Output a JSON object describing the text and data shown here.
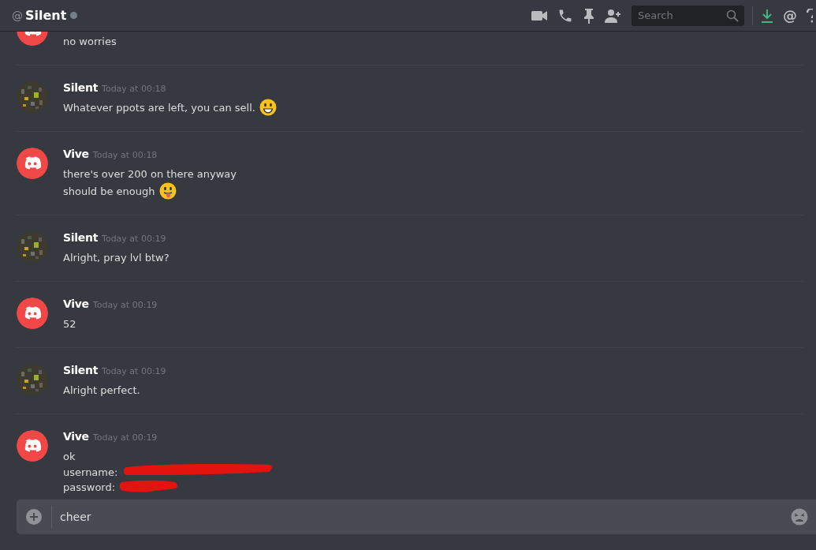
{
  "header": {
    "at_sign": "@",
    "title": "Silent",
    "status": {
      "kind": "offline"
    },
    "search": {
      "placeholder": "Search"
    }
  },
  "messages": [
    {
      "avatar": {
        "kind": "logo"
      },
      "lines": [
        {
          "text": "no worries"
        }
      ]
    },
    {
      "avatar": {
        "kind": "picture"
      },
      "author": "Silent",
      "time": "Today at 00:18",
      "lines": [
        {
          "text": "Whatever ppots are left, you can sell.",
          "emoji": {
            "kind": "smile"
          }
        }
      ]
    },
    {
      "avatar": {
        "kind": "logo"
      },
      "author": "Vive",
      "time": "Today at 00:18",
      "lines": [
        {
          "text": "there's over 200 on there anyway"
        },
        {
          "text": "should be enough",
          "emoji": {
            "kind": "tongue"
          }
        }
      ]
    },
    {
      "avatar": {
        "kind": "picture"
      },
      "author": "Silent",
      "time": "Today at 00:19",
      "lines": [
        {
          "text": "Alright, pray lvl btw?"
        }
      ]
    },
    {
      "avatar": {
        "kind": "logo"
      },
      "author": "Vive",
      "time": "Today at 00:19",
      "lines": [
        {
          "text": "52"
        }
      ]
    },
    {
      "avatar": {
        "kind": "picture"
      },
      "author": "Silent",
      "time": "Today at 00:19",
      "lines": [
        {
          "text": "Alright perfect."
        }
      ]
    },
    {
      "avatar": {
        "kind": "logo"
      },
      "author": "Vive",
      "time": "Today at 00:19",
      "lines": [
        {
          "text": "ok"
        },
        {
          "text": "username:",
          "redaction": {
            "kind": "long"
          }
        },
        {
          "text": "password:",
          "redaction": {
            "kind": "short"
          }
        }
      ]
    }
  ],
  "composer": {
    "value": "cheer"
  }
}
